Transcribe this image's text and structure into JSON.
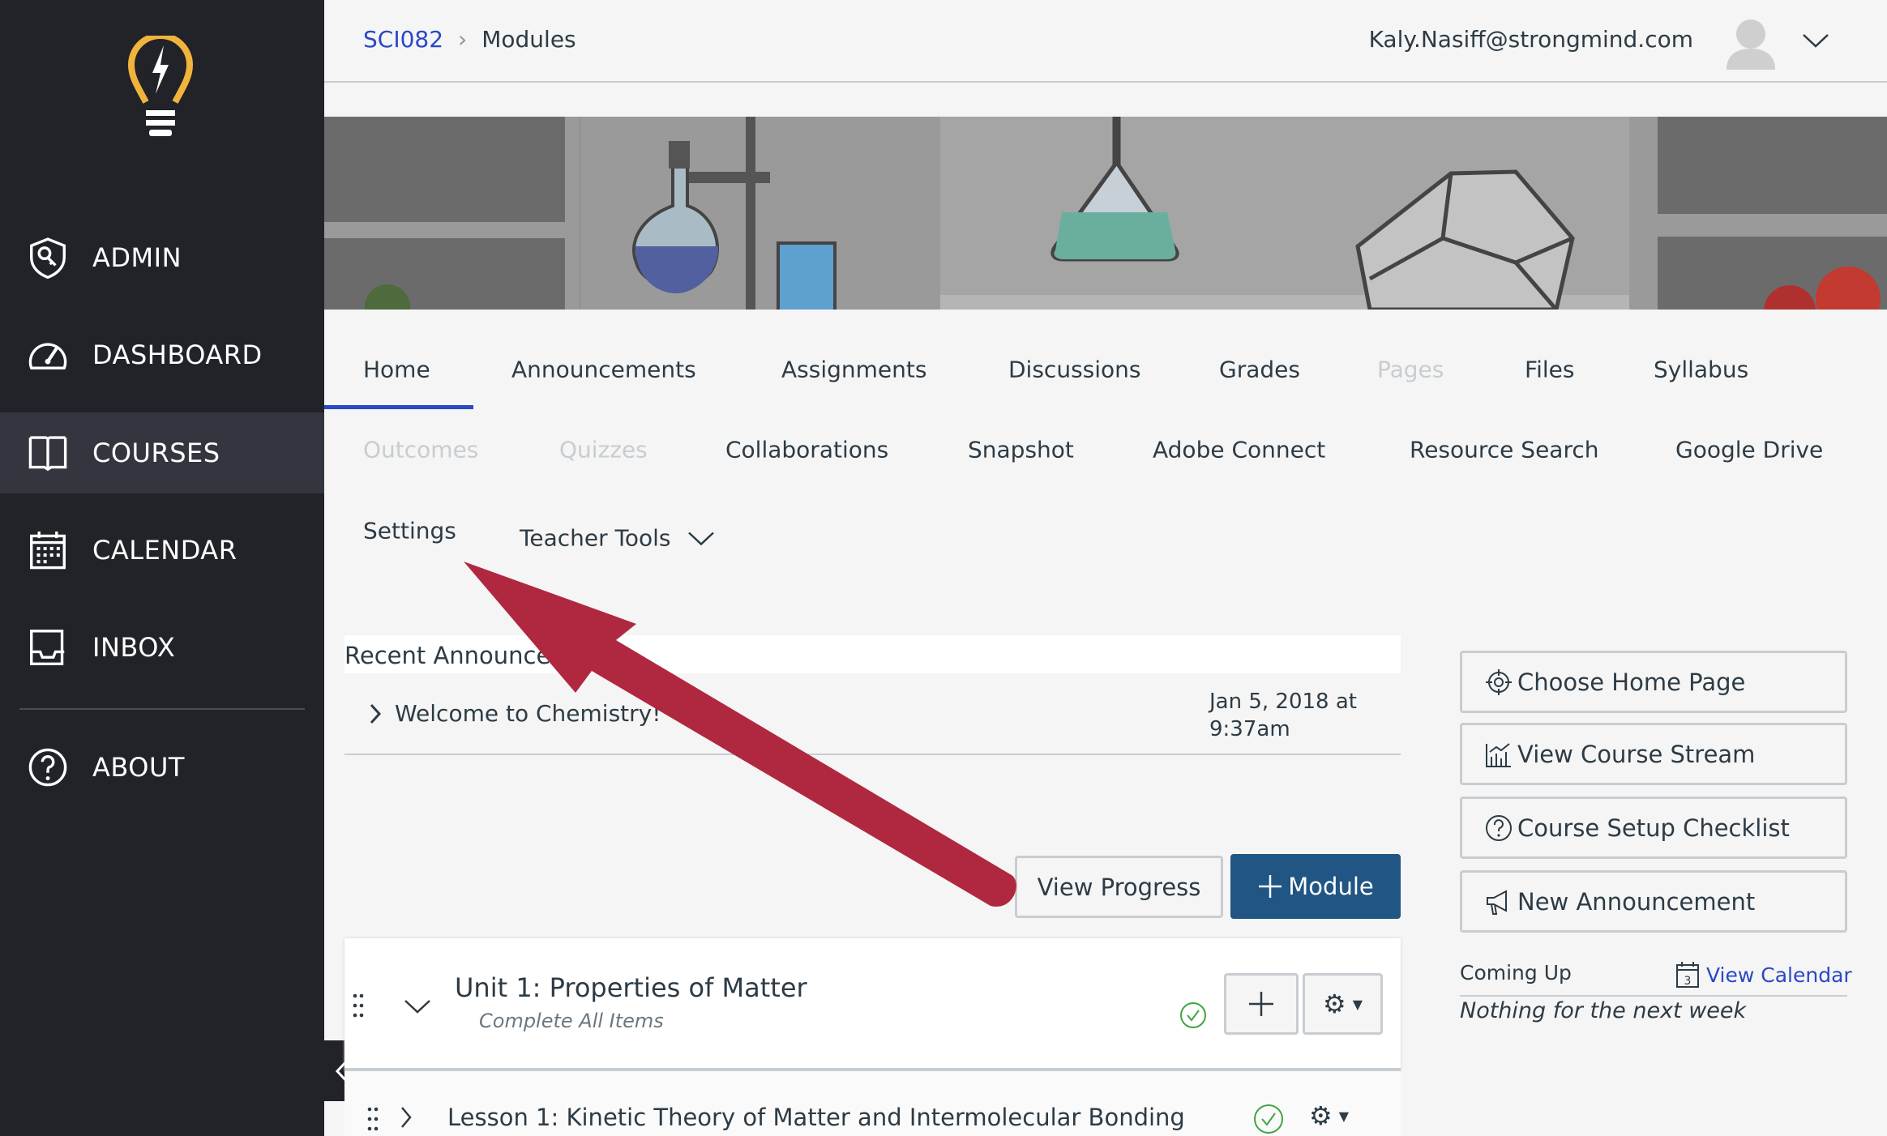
{
  "sidebar": {
    "items": [
      {
        "label": "ADMIN",
        "icon": "shield-key-icon"
      },
      {
        "label": "DASHBOARD",
        "icon": "speedometer-icon"
      },
      {
        "label": "COURSES",
        "icon": "book-icon",
        "active": true
      },
      {
        "label": "CALENDAR",
        "icon": "calendar-icon"
      },
      {
        "label": "INBOX",
        "icon": "inbox-icon"
      },
      {
        "label": "ABOUT",
        "icon": "question-circle-icon"
      }
    ],
    "logo_color": "#f0b43c",
    "bg_color": "#212329"
  },
  "header": {
    "breadcrumb": {
      "course": "SCI082",
      "page": "Modules"
    },
    "user_email": "Kaly.Nasiff@strongmind.com"
  },
  "course_nav": {
    "rows": [
      [
        {
          "label": "Home",
          "active": true
        },
        {
          "label": "Announcements"
        },
        {
          "label": "Assignments"
        },
        {
          "label": "Discussions"
        },
        {
          "label": "Grades"
        },
        {
          "label": "Pages",
          "disabled": true
        },
        {
          "label": "Files"
        },
        {
          "label": "Syllabus"
        }
      ],
      [
        {
          "label": "Outcomes",
          "disabled": true
        },
        {
          "label": "Quizzes",
          "disabled": true
        },
        {
          "label": "Collaborations"
        },
        {
          "label": "Snapshot"
        },
        {
          "label": "Adobe Connect"
        },
        {
          "label": "Resource Search"
        },
        {
          "label": "Google Drive"
        }
      ],
      [
        {
          "label": "Settings"
        },
        {
          "label": "Teacher Tools"
        }
      ]
    ]
  },
  "announcements": {
    "title": "Recent Announcements",
    "items": [
      {
        "title": "Welcome to Chemistry!",
        "date_line1": "Jan 5, 2018 at",
        "date_line2": "9:37am"
      }
    ]
  },
  "toolbar": {
    "view_progress": "View Progress",
    "add_module": "Module",
    "accent": "#215583"
  },
  "modules": [
    {
      "title": "Unit 1: Properties of Matter",
      "requirement": "Complete All Items",
      "published": true,
      "items": [
        {
          "title": "Lesson 1: Kinetic Theory of Matter and Intermolecular Bonding",
          "published": true
        }
      ]
    }
  ],
  "right_panel": {
    "buttons": [
      {
        "label": "Choose Home Page",
        "icon": "target-icon"
      },
      {
        "label": "View Course Stream",
        "icon": "chart-icon"
      },
      {
        "label": "Course Setup Checklist",
        "icon": "question-circle-icon"
      },
      {
        "label": "New Announcement",
        "icon": "megaphone-icon"
      }
    ],
    "coming_up": "Coming Up",
    "view_calendar": "View Calendar",
    "calendar_day": "3",
    "empty_text": "Nothing for the next week"
  },
  "annotation_arrow_color": "#b0283f"
}
